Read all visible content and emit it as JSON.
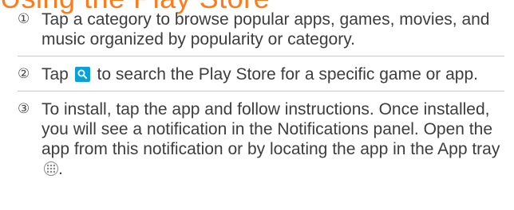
{
  "heading": "Using the Play Store",
  "steps": [
    {
      "number": "①",
      "text": "Tap a category to browse popular apps, games, movies, and music organized by popularity or category."
    },
    {
      "number": "②",
      "text_before": "Tap",
      "icon": "search-icon",
      "text_after": "to search the Play Store for a specific game or app."
    },
    {
      "number": "③",
      "text_before": "To install, tap the app and follow instructions. Once installed, you will see a notification in the Notifications panel. Open the app from this notification or by locating the app in the App tray",
      "icon": "app-tray-icon",
      "text_after": "."
    }
  ],
  "colors": {
    "heading": "#ff7a1a",
    "text": "#3d3d3d",
    "search_icon_bg": "#0aa1d6",
    "divider": "#c7c7c7"
  }
}
